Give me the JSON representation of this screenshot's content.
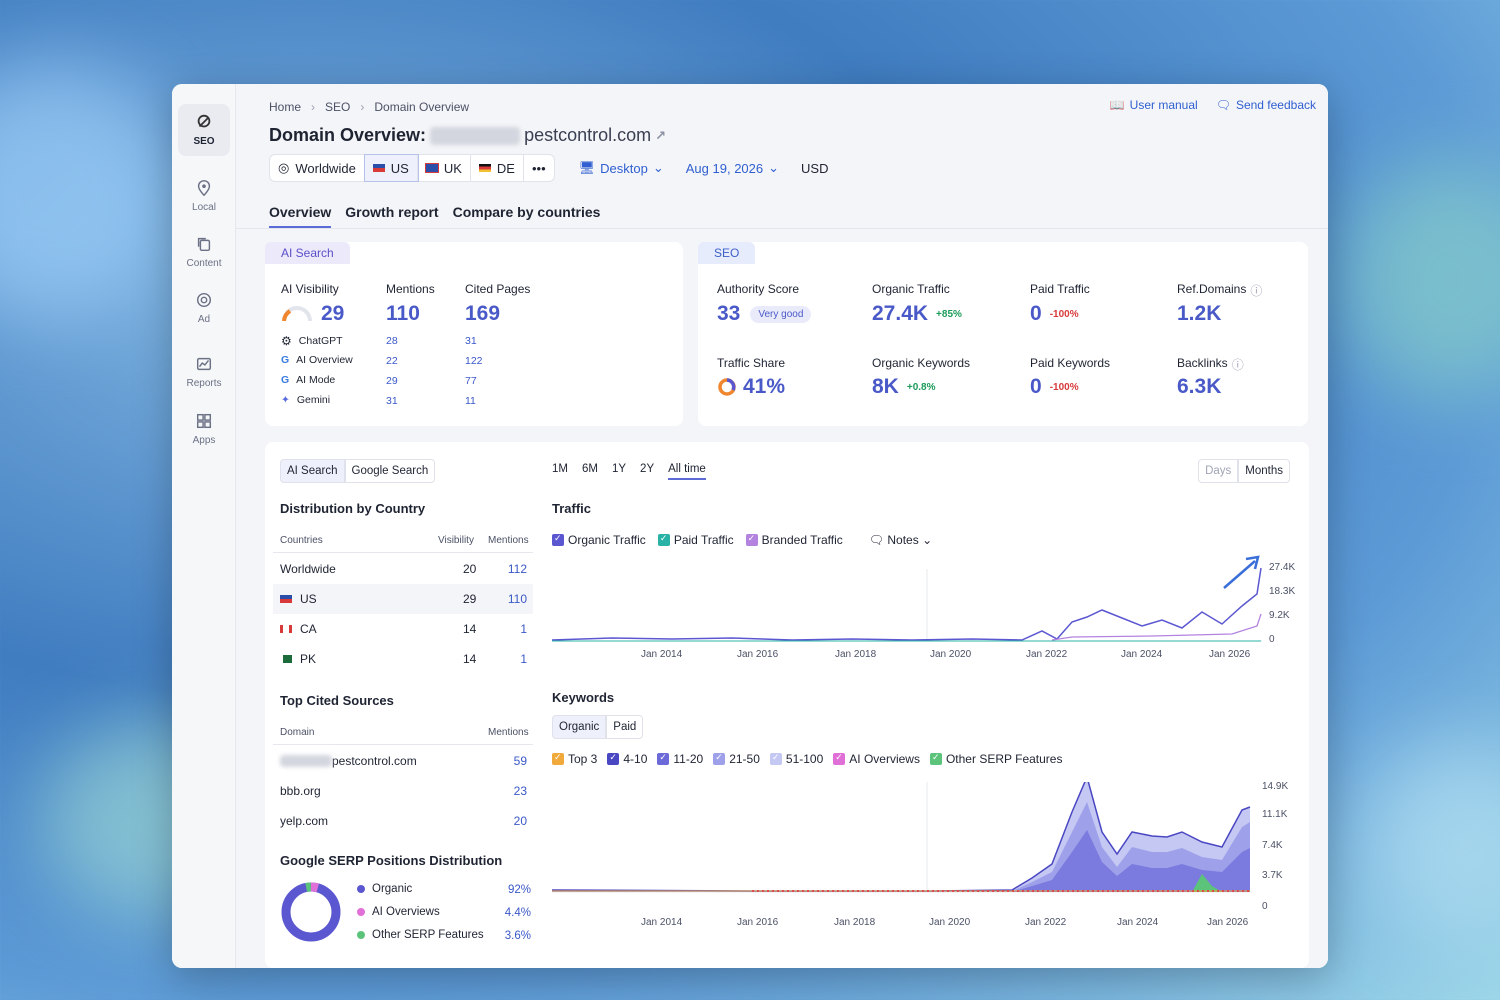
{
  "breadcrumb": [
    "Home",
    "SEO",
    "Domain Overview"
  ],
  "top_links": {
    "manual": "User manual",
    "feedback": "Send feedback"
  },
  "title": {
    "prefix": "Domain Overview:",
    "domain": "pestcontrol.com"
  },
  "rail": [
    {
      "label": "SEO",
      "icon": "seo-icon"
    },
    {
      "label": "Local",
      "icon": "pin-icon"
    },
    {
      "label": "Content",
      "icon": "copy-icon"
    },
    {
      "label": "Ad",
      "icon": "ad-icon"
    },
    {
      "label": "Reports",
      "icon": "chart-icon"
    },
    {
      "label": "Apps",
      "icon": "grid-icon"
    }
  ],
  "filters": {
    "worldwide": "Worldwide",
    "us": "US",
    "uk": "UK",
    "de": "DE",
    "more": "•••",
    "device": "Desktop",
    "date": "Aug 19, 2026",
    "currency": "USD"
  },
  "tabs": [
    "Overview",
    "Growth report",
    "Compare by countries"
  ],
  "ai_search": {
    "pill": "AI Search",
    "visibility_label": "AI Visibility",
    "visibility": "29",
    "mentions_label": "Mentions",
    "mentions": "110",
    "cited_label": "Cited Pages",
    "cited": "169",
    "rows": [
      {
        "name": "ChatGPT",
        "mentions": "28",
        "cited": "31"
      },
      {
        "name": "AI Overview",
        "mentions": "22",
        "cited": "122"
      },
      {
        "name": "AI Mode",
        "mentions": "29",
        "cited": "77"
      },
      {
        "name": "Gemini",
        "mentions": "31",
        "cited": "11"
      }
    ]
  },
  "seo": {
    "pill": "SEO",
    "authority_label": "Authority Score",
    "authority": "33",
    "authority_badge": "Very good",
    "organic_label": "Organic Traffic",
    "organic": "27.4K",
    "organic_delta": "+85%",
    "paid_label": "Paid Traffic",
    "paid": "0",
    "paid_delta": "-100%",
    "refdomains_label": "Ref.Domains",
    "refdomains": "1.2K",
    "share_label": "Traffic Share",
    "share": "41%",
    "okw_label": "Organic Keywords",
    "okw": "8K",
    "okw_delta": "+0.8%",
    "pkw_label": "Paid Keywords",
    "pkw": "0",
    "pkw_delta": "-100%",
    "backlinks_label": "Backlinks",
    "backlinks": "6.3K"
  },
  "left_panel": {
    "toggle": [
      "AI Search",
      "Google Search"
    ],
    "dist_title": "Distribution by Country",
    "dist_headers": [
      "Countries",
      "Visibility",
      "Mentions"
    ],
    "dist_rows": [
      {
        "country": "Worldwide",
        "visibility": "20",
        "mentions": "112"
      },
      {
        "country": "US",
        "visibility": "29",
        "mentions": "110"
      },
      {
        "country": "CA",
        "visibility": "14",
        "mentions": "1"
      },
      {
        "country": "PK",
        "visibility": "14",
        "mentions": "1"
      }
    ],
    "cited_title": "Top Cited Sources",
    "cited_headers": [
      "Domain",
      "Mentions"
    ],
    "cited_rows": [
      {
        "domain": "pestcontrol.com",
        "mentions": "59"
      },
      {
        "domain": "bbb.org",
        "mentions": "23"
      },
      {
        "domain": "yelp.com",
        "mentions": "20"
      }
    ],
    "serp_title": "Google SERP Positions Distribution",
    "serp_rows": [
      {
        "name": "Organic",
        "value": "92%",
        "color": "#5b57d1"
      },
      {
        "name": "AI Overviews",
        "value": "4.4%",
        "color": "#e070d8"
      },
      {
        "name": "Other SERP Features",
        "value": "3.6%",
        "color": "#5cc47a"
      }
    ]
  },
  "range": [
    "1M",
    "6M",
    "1Y",
    "2Y",
    "All time"
  ],
  "granularity": [
    "Days",
    "Months"
  ],
  "traffic": {
    "title": "Traffic",
    "legend": [
      "Organic Traffic",
      "Paid Traffic",
      "Branded Traffic"
    ],
    "notes": "Notes",
    "y_ticks": [
      "27.4K",
      "18.3K",
      "9.2K",
      "0"
    ],
    "x_ticks": [
      "Jan 2014",
      "Jan 2016",
      "Jan 2018",
      "Jan 2020",
      "Jan 2022",
      "Jan 2024",
      "Jan 2026"
    ]
  },
  "keywords": {
    "title": "Keywords",
    "toggle": [
      "Organic",
      "Paid"
    ],
    "legend": [
      "Top 3",
      "4-10",
      "11-20",
      "21-50",
      "51-100",
      "AI Overviews",
      "Other SERP Features"
    ],
    "y_ticks": [
      "14.9K",
      "11.1K",
      "7.4K",
      "3.7K",
      "0"
    ],
    "x_ticks": [
      "Jan 2014",
      "Jan 2016",
      "Jan 2018",
      "Jan 2020",
      "Jan 2022",
      "Jan 2024",
      "Jan 2026"
    ]
  },
  "colors": {
    "accent": "#4a59c8",
    "organic": "#5b57d1",
    "paid": "#28b3a6",
    "branded": "#b483e0",
    "top3": "#f0a93a",
    "k410": "#4a47c2",
    "k1120": "#6c6ad8",
    "k2150": "#9ea1ea",
    "k51100": "#c5c8f3",
    "aiov": "#e070d8",
    "other": "#5cc47a"
  },
  "chart_data": [
    {
      "type": "line",
      "title": "Traffic",
      "series": [
        {
          "name": "Organic Traffic",
          "x": [
            "Jan 2014",
            "Jan 2016",
            "Jan 2018",
            "Jan 2020",
            "Jan 2022",
            "Jan 2024",
            "Jan 2026"
          ],
          "values": [
            900,
            1200,
            700,
            500,
            2000,
            9000,
            27400
          ]
        },
        {
          "name": "Paid Traffic",
          "x": [
            "Jan 2014",
            "Jan 2016",
            "Jan 2018",
            "Jan 2020",
            "Jan 2022",
            "Jan 2024",
            "Jan 2026"
          ],
          "values": [
            0,
            0,
            0,
            0,
            0,
            0,
            0
          ]
        },
        {
          "name": "Branded Traffic",
          "x": [
            "Jan 2014",
            "Jan 2016",
            "Jan 2018",
            "Jan 2020",
            "Jan 2022",
            "Jan 2024",
            "Jan 2026"
          ],
          "values": [
            0,
            0,
            0,
            0,
            1500,
            1800,
            4000
          ]
        }
      ],
      "ylim": [
        0,
        27400
      ]
    },
    {
      "type": "area",
      "title": "Keywords",
      "series": [
        {
          "name": "Organic",
          "x": [
            "Jan 2014",
            "Jan 2016",
            "Jan 2018",
            "Jan 2020",
            "Jan 2022",
            "Jan 2024",
            "Jan 2026"
          ],
          "values": [
            200,
            300,
            200,
            200,
            3000,
            7000,
            14000
          ]
        }
      ],
      "ylim": [
        0,
        14900
      ]
    }
  ]
}
